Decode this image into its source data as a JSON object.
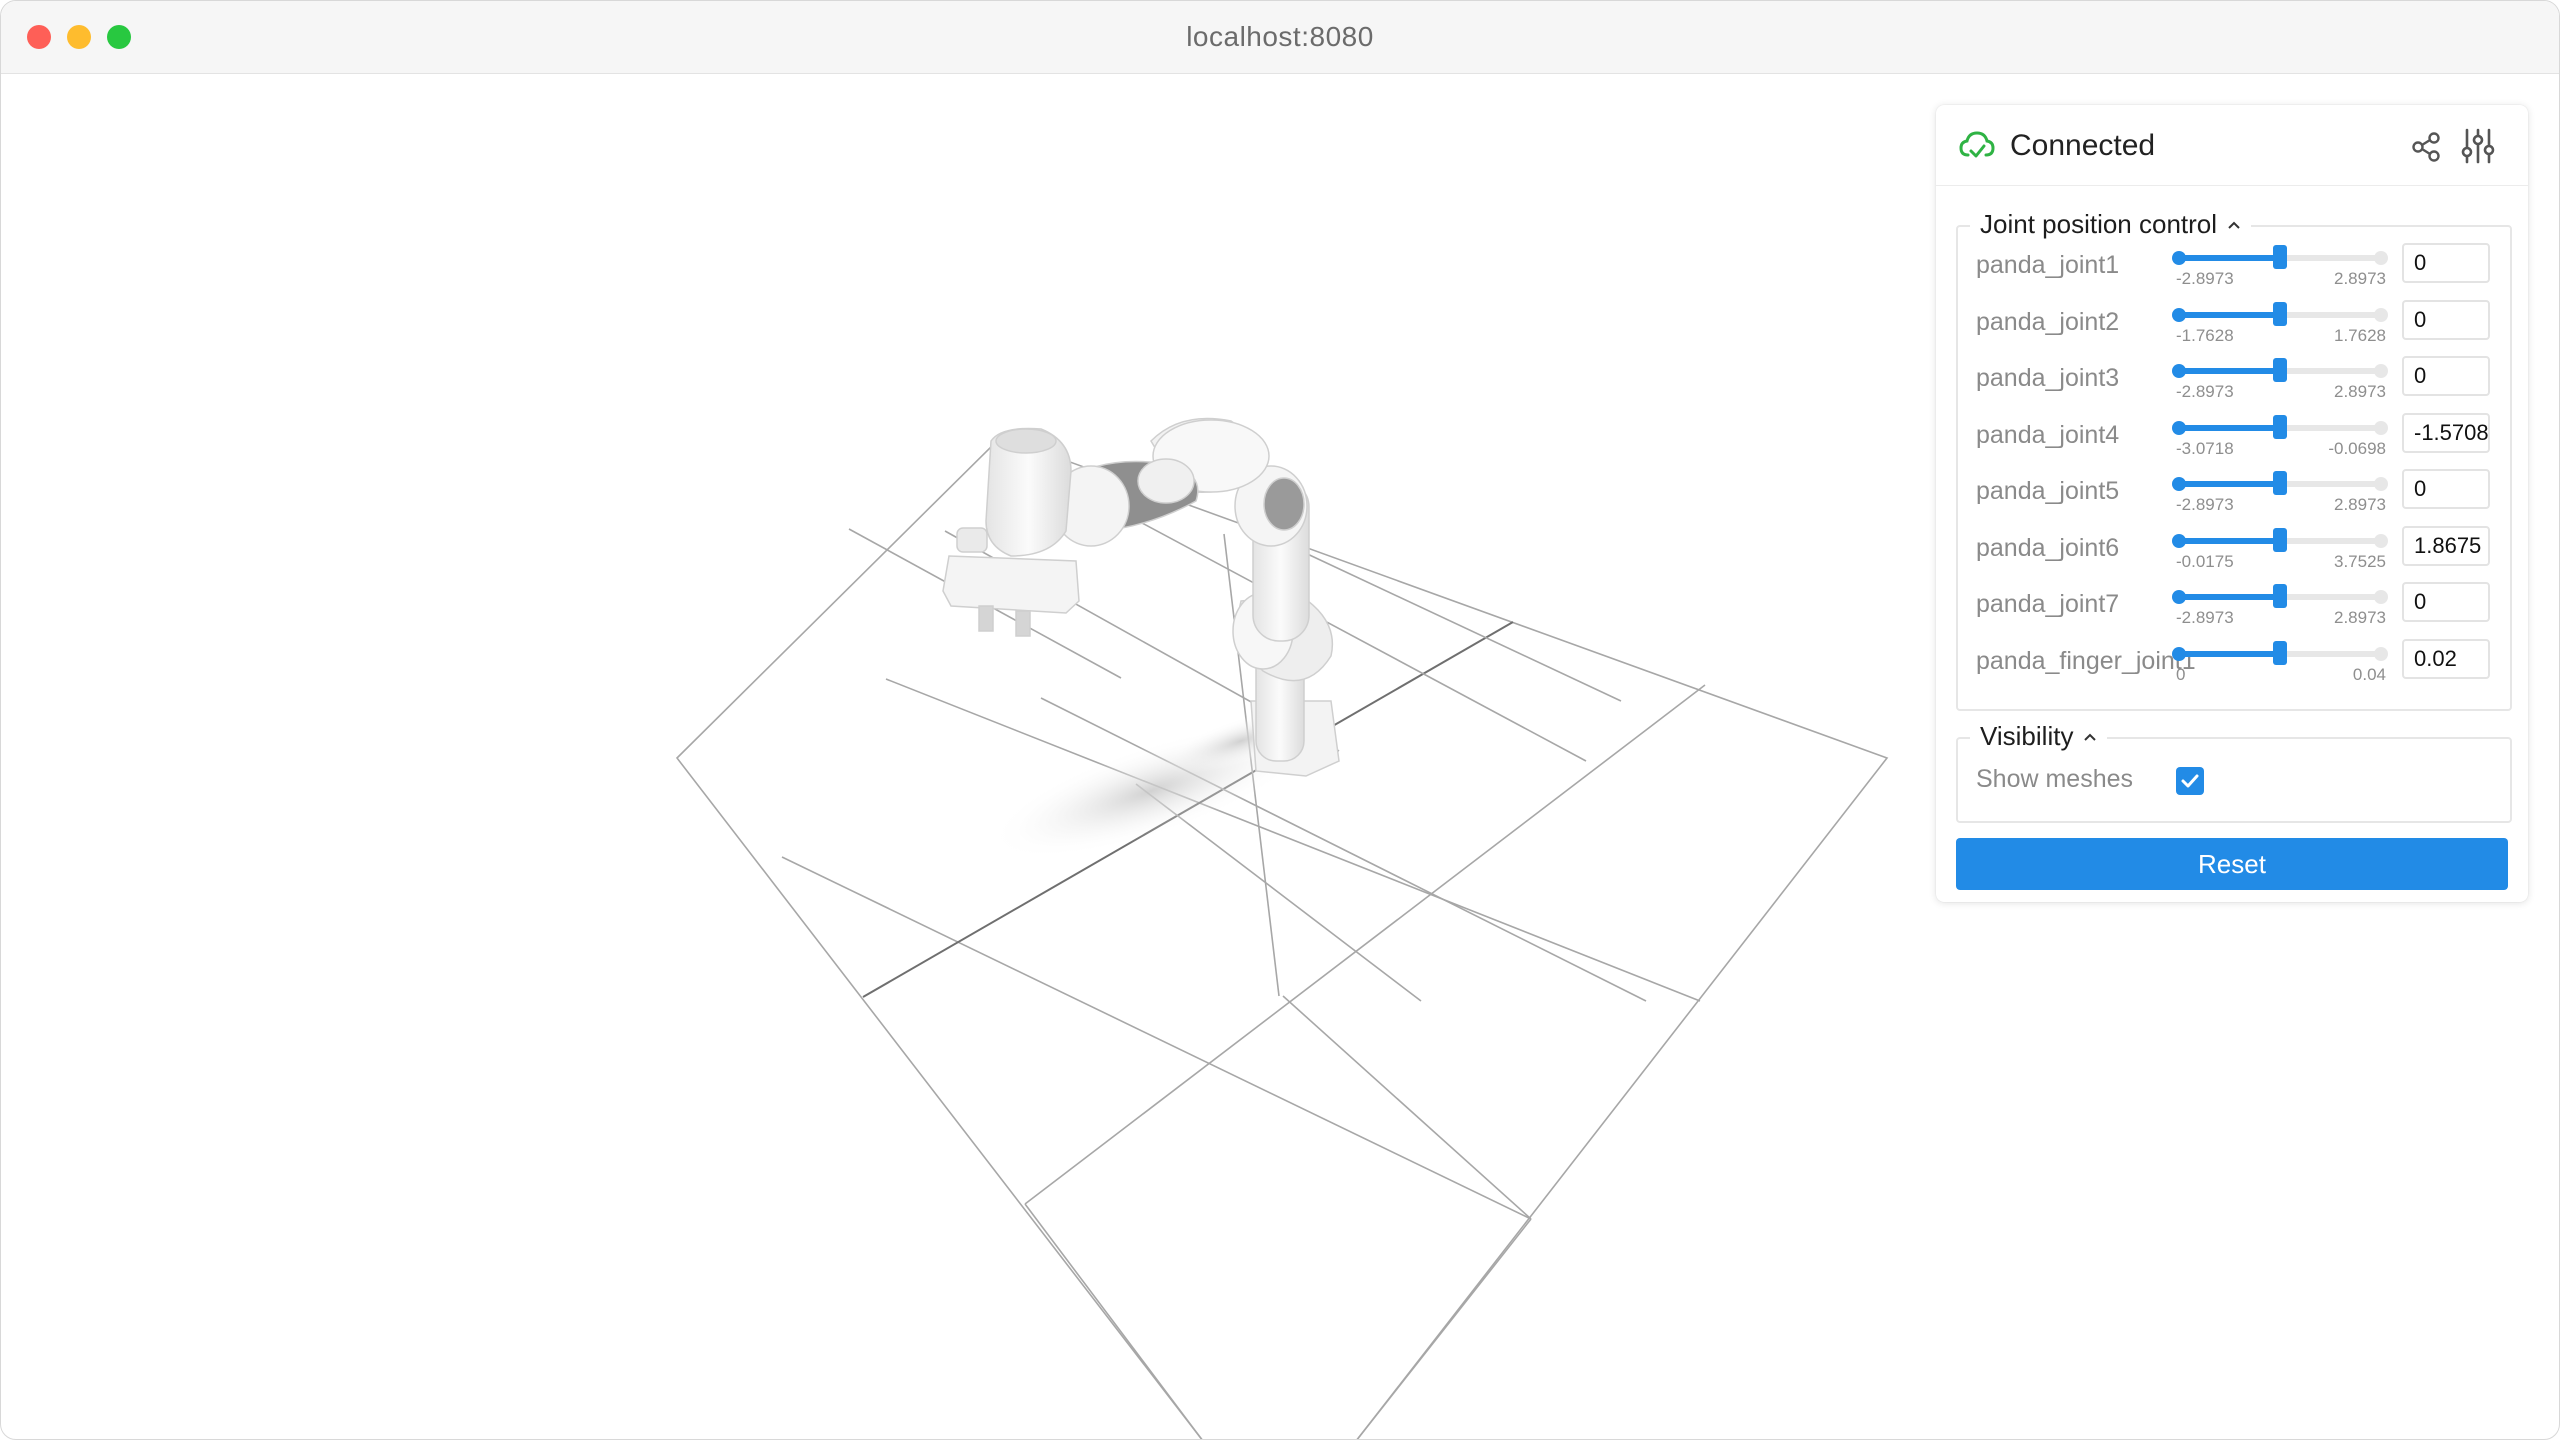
{
  "browser": {
    "url": "localhost:8080"
  },
  "scene": {
    "description_icon": "robot-arm-3d-view",
    "grid_color": "#9a9a9a",
    "robot_color": "#f0f0f0",
    "robot_dark": "#8c8c8c"
  },
  "panel": {
    "status": "Connected",
    "status_color": "#2fb344",
    "accent": "#228be6",
    "joint_section_title": "Joint position control",
    "visibility_section_title": "Visibility",
    "show_meshes_label": "Show meshes",
    "show_meshes_checked": true,
    "reset_label": "Reset",
    "joints": [
      {
        "name": "panda_joint1",
        "min": "-2.8973",
        "max": "2.8973",
        "value": "0",
        "fraction": 0.5
      },
      {
        "name": "panda_joint2",
        "min": "-1.7628",
        "max": "1.7628",
        "value": "0",
        "fraction": 0.5
      },
      {
        "name": "panda_joint3",
        "min": "-2.8973",
        "max": "2.8973",
        "value": "0",
        "fraction": 0.5
      },
      {
        "name": "panda_joint4",
        "min": "-3.0718",
        "max": "-0.0698",
        "value": "-1.5708",
        "fraction": 0.5
      },
      {
        "name": "panda_joint5",
        "min": "-2.8973",
        "max": "2.8973",
        "value": "0",
        "fraction": 0.5
      },
      {
        "name": "panda_joint6",
        "min": "-0.0175",
        "max": "3.7525",
        "value": "1.8675",
        "fraction": 0.5
      },
      {
        "name": "panda_joint7",
        "min": "-2.8973",
        "max": "2.8973",
        "value": "0",
        "fraction": 0.5
      },
      {
        "name": "panda_finger_joint1",
        "min": "0",
        "max": "0.04",
        "value": "0.02",
        "fraction": 0.5
      }
    ]
  }
}
